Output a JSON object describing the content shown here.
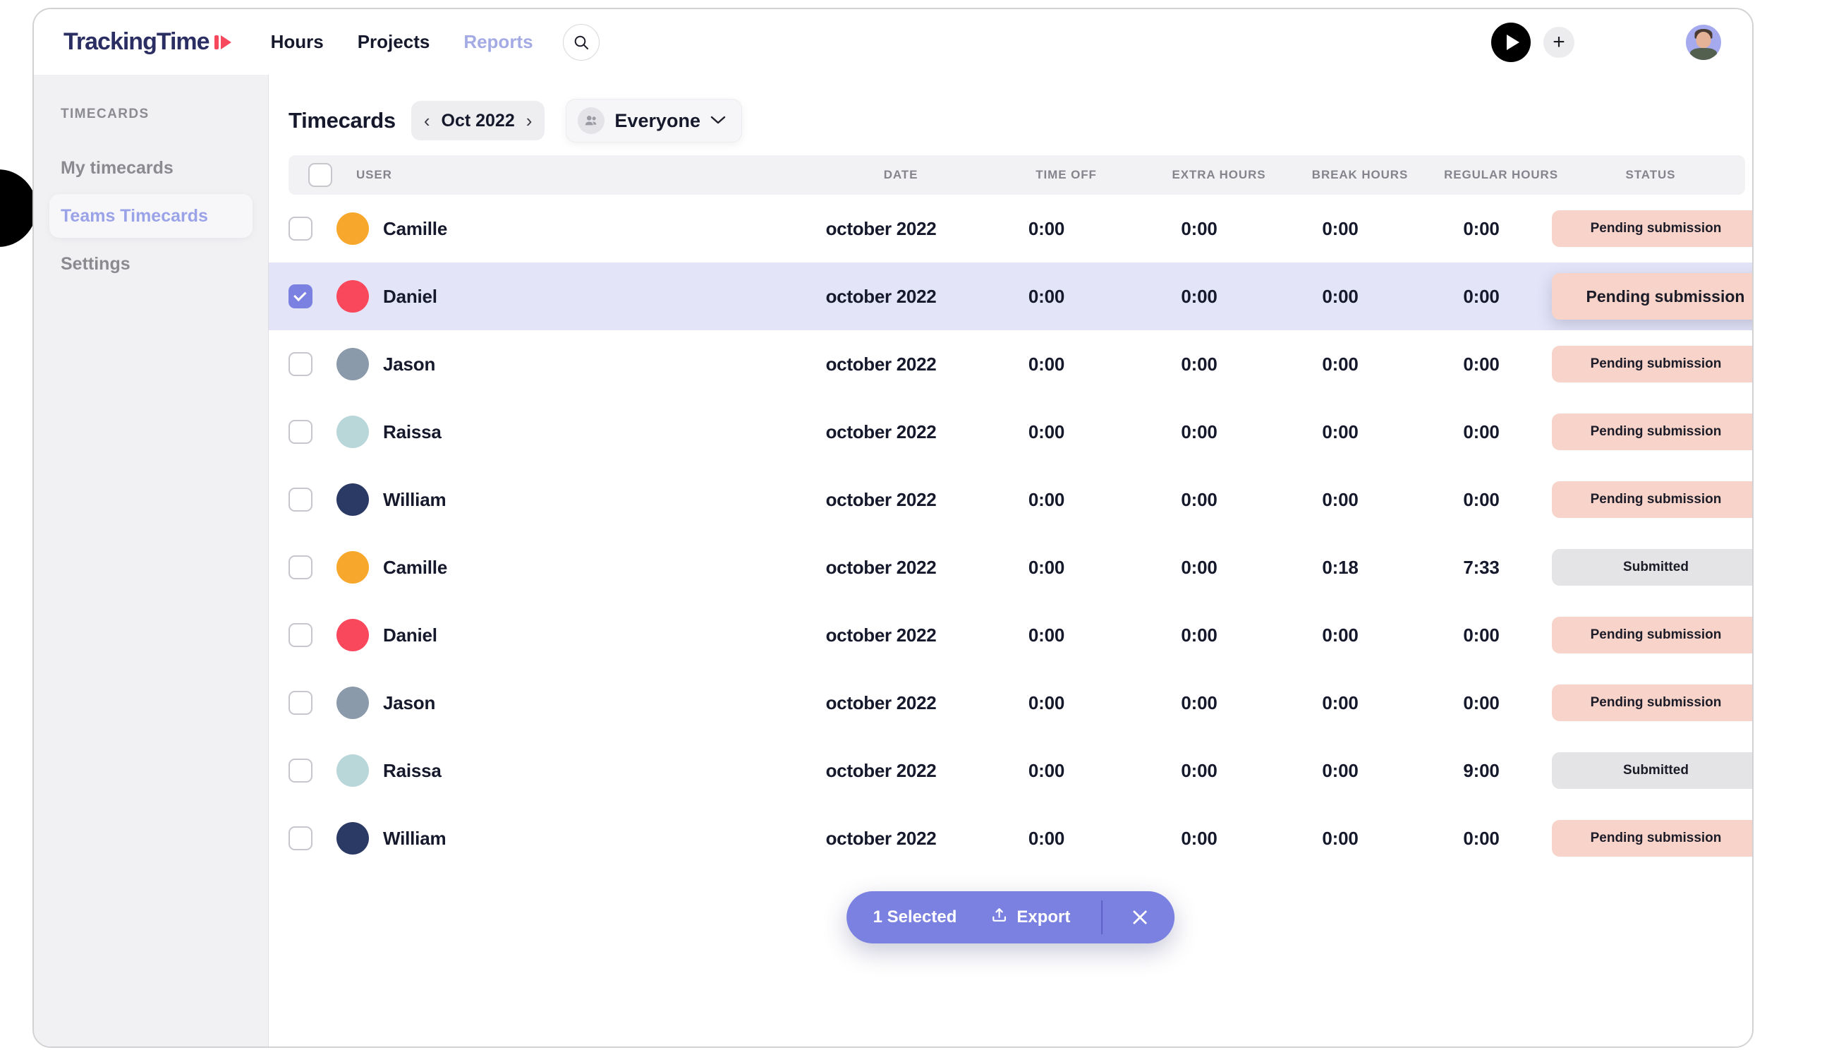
{
  "app": {
    "logo_text": "TrackingTime",
    "nav": [
      {
        "label": "Hours",
        "active": true
      },
      {
        "label": "Projects",
        "active": true
      },
      {
        "label": "Reports",
        "active": false
      }
    ],
    "search_icon": "search-icon",
    "play_icon": "play-icon",
    "plus_icon": "plus-icon",
    "avatar_icon": "user-avatar"
  },
  "sidebar": {
    "section_label": "TIMECARDS",
    "items": [
      {
        "label": "My timecards",
        "active": false
      },
      {
        "label": "Teams Timecards",
        "active": true
      },
      {
        "label": "Settings",
        "active": false
      }
    ]
  },
  "page": {
    "title": "Timecards",
    "month": "Oct 2022",
    "prev_arrow": "‹",
    "next_arrow": "›",
    "people_filter": "Everyone",
    "people_icon": "group-icon",
    "chevron": "⌄"
  },
  "table": {
    "columns": [
      "USER",
      "DATE",
      "TIME OFF",
      "EXTRA HOURS",
      "BREAK HOURS",
      "REGULAR HOURS",
      "STATUS"
    ],
    "rows": [
      {
        "user": "Camille",
        "date": "october 2022",
        "time_off": "0:00",
        "extra_hours": "0:00",
        "break_hours": "0:00",
        "regular_hours": "0:00",
        "status": "Pending submission",
        "status_kind": "pending",
        "selected": false,
        "avatar_color": "#f7a72b"
      },
      {
        "user": "Daniel",
        "date": "october 2022",
        "time_off": "0:00",
        "extra_hours": "0:00",
        "break_hours": "0:00",
        "regular_hours": "0:00",
        "status": "Pending submission",
        "status_kind": "pending",
        "selected": true,
        "avatar_color": "#f9485c"
      },
      {
        "user": "Jason",
        "date": "october 2022",
        "time_off": "0:00",
        "extra_hours": "0:00",
        "break_hours": "0:00",
        "regular_hours": "0:00",
        "status": "Pending submission",
        "status_kind": "pending",
        "selected": false,
        "avatar_color": "#8b9aab"
      },
      {
        "user": "Raissa",
        "date": "october 2022",
        "time_off": "0:00",
        "extra_hours": "0:00",
        "break_hours": "0:00",
        "regular_hours": "0:00",
        "status": "Pending submission",
        "status_kind": "pending",
        "selected": false,
        "avatar_color": "#b9d7d9"
      },
      {
        "user": "William",
        "date": "october 2022",
        "time_off": "0:00",
        "extra_hours": "0:00",
        "break_hours": "0:00",
        "regular_hours": "0:00",
        "status": "Pending submission",
        "status_kind": "pending",
        "selected": false,
        "avatar_color": "#2b3a64"
      },
      {
        "user": "Camille",
        "date": "october 2022",
        "time_off": "0:00",
        "extra_hours": "0:00",
        "break_hours": "0:18",
        "regular_hours": "7:33",
        "status": "Submitted",
        "status_kind": "submitted",
        "selected": false,
        "avatar_color": "#f7a72b"
      },
      {
        "user": "Daniel",
        "date": "october 2022",
        "time_off": "0:00",
        "extra_hours": "0:00",
        "break_hours": "0:00",
        "regular_hours": "0:00",
        "status": "Pending submission",
        "status_kind": "pending",
        "selected": false,
        "avatar_color": "#f9485c"
      },
      {
        "user": "Jason",
        "date": "october 2022",
        "time_off": "0:00",
        "extra_hours": "0:00",
        "break_hours": "0:00",
        "regular_hours": "0:00",
        "status": "Pending submission",
        "status_kind": "pending",
        "selected": false,
        "avatar_color": "#8b9aab"
      },
      {
        "user": "Raissa",
        "date": "october 2022",
        "time_off": "0:00",
        "extra_hours": "0:00",
        "break_hours": "0:00",
        "regular_hours": "9:00",
        "status": "Submitted",
        "status_kind": "submitted",
        "selected": false,
        "avatar_color": "#b9d7d9"
      },
      {
        "user": "William",
        "date": "october 2022",
        "time_off": "0:00",
        "extra_hours": "0:00",
        "break_hours": "0:00",
        "regular_hours": "0:00",
        "status": "Pending submission",
        "status_kind": "pending",
        "selected": false,
        "avatar_color": "#2b3a64"
      }
    ]
  },
  "action_bar": {
    "selected_label": "1 Selected",
    "export_label": "Export",
    "export_icon": "upload-icon",
    "close_icon": "close-icon"
  },
  "colors": {
    "accent": "#7b81e0",
    "selected_row": "#e3e4f8",
    "pending_badge": "#f8d3c9",
    "submitted_badge": "#e4e4e6",
    "logo_navy": "#2b2e63",
    "logo_red": "#f8485e",
    "sidebar_bg": "#f1f1f4"
  }
}
